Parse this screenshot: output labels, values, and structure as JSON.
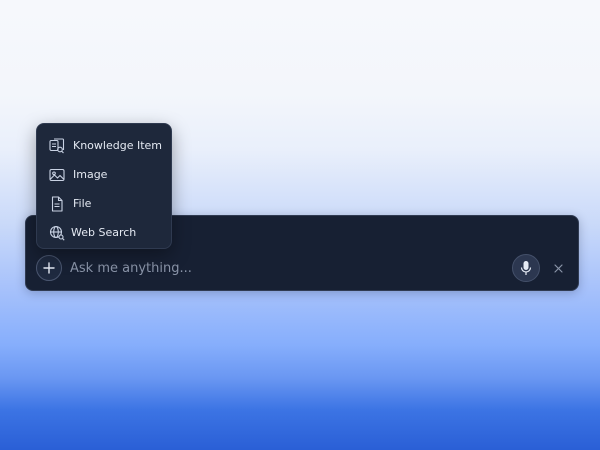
{
  "chat": {
    "input_value": "",
    "placeholder": "Ask me anything..."
  },
  "attach_menu": {
    "items": [
      {
        "label": "Knowledge Item",
        "icon": "knowledge-item-icon"
      },
      {
        "label": "Image",
        "icon": "image-icon"
      },
      {
        "label": "File",
        "icon": "file-icon"
      },
      {
        "label": "Web Search",
        "icon": "web-search-icon"
      }
    ]
  },
  "icons": {
    "attach": "plus-icon",
    "voice": "microphone-icon",
    "close": "close-icon"
  },
  "colors": {
    "panel": "#172033",
    "menu": "#1e283b",
    "text": "#e4e9f2",
    "placeholder": "#8a94a8"
  }
}
